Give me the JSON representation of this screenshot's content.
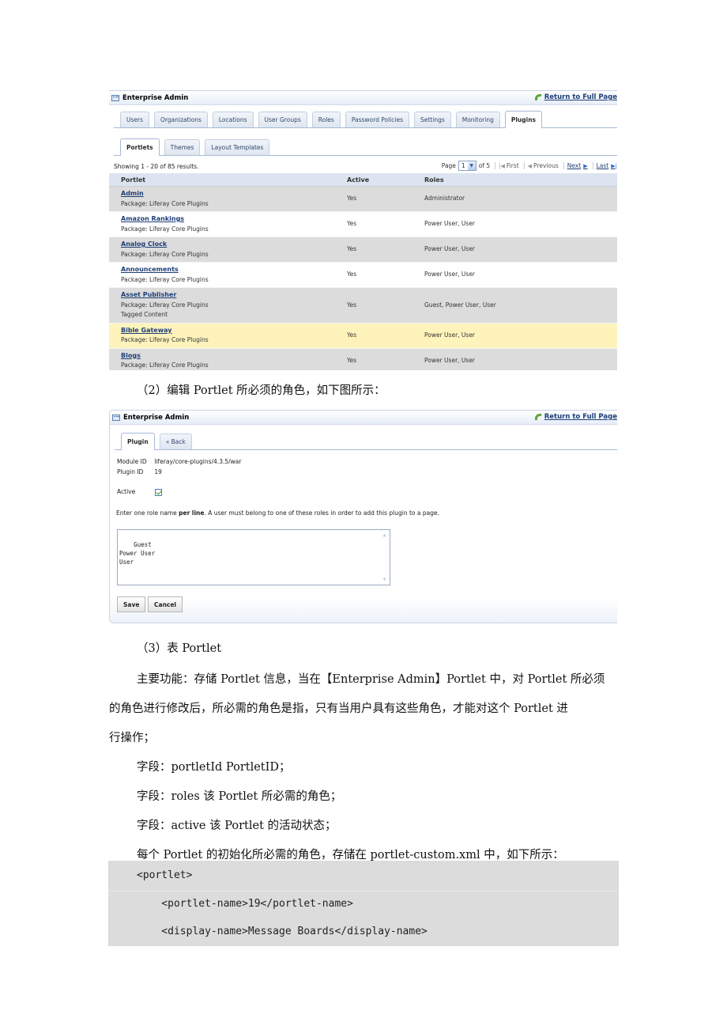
{
  "portlet1": {
    "title": "Enterprise Admin",
    "return_link": "Return to Full Page",
    "main_tabs": [
      {
        "label": "Users",
        "selected": false
      },
      {
        "label": "Organizations",
        "selected": false
      },
      {
        "label": "Locations",
        "selected": false
      },
      {
        "label": "User Groups",
        "selected": false
      },
      {
        "label": "Roles",
        "selected": false
      },
      {
        "label": "Password Policies",
        "selected": false
      },
      {
        "label": "Settings",
        "selected": false
      },
      {
        "label": "Monitoring",
        "selected": false
      },
      {
        "label": "Plugins",
        "selected": true
      }
    ],
    "sub_tabs": [
      {
        "label": "Portlets",
        "selected": true
      },
      {
        "label": "Themes",
        "selected": false
      },
      {
        "label": "Layout Templates",
        "selected": false
      }
    ],
    "showing": "Showing 1 - 20 of 85 results.",
    "pager": {
      "page_label": "Page",
      "current_page": "1",
      "of_label": "of 5",
      "first": "First",
      "previous": "Previous",
      "next": "Next",
      "last": "Last"
    },
    "columns": [
      "Portlet",
      "Active",
      "Roles"
    ],
    "rows": [
      {
        "name": "Admin",
        "package": "Package: Liferay Core Plugins",
        "extra": "",
        "active": "Yes",
        "roles": "Administrator",
        "style": "alt"
      },
      {
        "name": "Amazon Rankings",
        "package": "Package: Liferay Core Plugins",
        "extra": "",
        "active": "Yes",
        "roles": "Power User, User",
        "style": "norm"
      },
      {
        "name": "Analog Clock",
        "package": "Package: Liferay Core Plugins",
        "extra": "",
        "active": "Yes",
        "roles": "Power User, User",
        "style": "alt"
      },
      {
        "name": "Announcements",
        "package": "Package: Liferay Core Plugins",
        "extra": "",
        "active": "Yes",
        "roles": "Power User, User",
        "style": "norm"
      },
      {
        "name": "Asset Publisher",
        "package": "Package: Liferay Core Plugins",
        "extra": "Tagged Content",
        "active": "Yes",
        "roles": "Guest, Power User, User",
        "style": "alt"
      },
      {
        "name": "Bible Gateway",
        "package": "Package: Liferay Core Plugins",
        "extra": "",
        "active": "Yes",
        "roles": "Power User, User",
        "style": "hover"
      },
      {
        "name": "Blogs",
        "package": "Package: Liferay Core Plugins",
        "extra": "",
        "active": "Yes",
        "roles": "Power User, User",
        "style": "alt"
      }
    ]
  },
  "caption2": "（2）编辑 Portlet 所必须的角色，如下图所示：",
  "portlet2": {
    "title": "Enterprise Admin",
    "return_link": "Return to Full Page",
    "tabs": [
      {
        "label": "Plugin",
        "selected": true
      },
      {
        "label": "« Back",
        "selected": false
      }
    ],
    "module_id_label": "Module ID",
    "module_id": "liferay/core-plugins/4.3.5/war",
    "plugin_id_label": "Plugin ID",
    "plugin_id": "19",
    "active_label": "Active",
    "active_checked": true,
    "hint_pre": "Enter one role name ",
    "hint_bold": "per line",
    "hint_post": ". A user must belong to one of these roles in order to add this plugin to a page.",
    "roles_text": "Guest\nPower User\nUser",
    "save_label": "Save",
    "cancel_label": "Cancel"
  },
  "doc": {
    "heading3": "（3）表 Portlet",
    "para_line1": "主要功能：存储 Portlet 信息，当在【Enterprise   Admin】Portlet 中，对 Portlet 所必须",
    "para_line2": "的角色进行修改后，所必需的角色是指，只有当用户具有这些角色，才能对这个 Portlet 进",
    "para_line3": "行操作；",
    "field1": "字段：portletId    PortletID；",
    "field2": "字段：roles  该 Portlet 所必需的角色；",
    "field3": "字段：active  该 Portlet 的活动状态；",
    "intro_code": "每个 Portlet 的初始化所必需的角色，存储在 portlet-custom.xml 中，如下所示：",
    "code": [
      "<portlet>",
      "    <portlet-name>19</portlet-name>",
      "    <display-name>Message Boards</display-name>"
    ]
  }
}
